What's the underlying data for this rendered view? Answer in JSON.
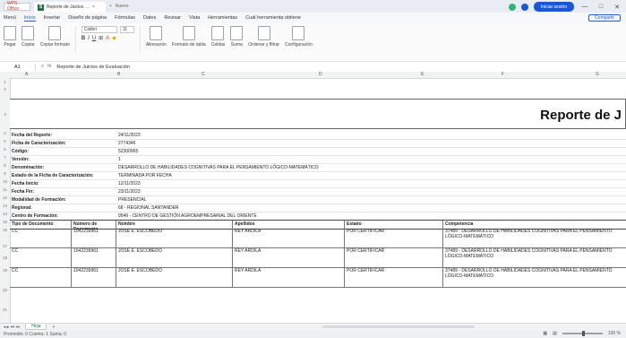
{
  "window": {
    "app_button": "WPS Office",
    "tab_title": "Reporte de Juicios Evaluativos",
    "tab_extra": "Nuevo",
    "signin": "Iniciar sesión",
    "min": "—",
    "max": "□",
    "close": "✕"
  },
  "menu": {
    "items": [
      "Menú",
      "Inicio",
      "Insertar",
      "Diseño de página",
      "Fórmulas",
      "Datos",
      "Revisar",
      "Vista",
      "Herramientas",
      "Cuál herramienta obtiene"
    ],
    "active_index": 1,
    "share": "Compartir"
  },
  "ribbon": {
    "paste": "Pegar",
    "copy": "Copiar",
    "format_painter": "Copiar formato",
    "font_name": "Calibri",
    "font_size": "11",
    "alignment": "Alineación",
    "format_table": "Formato de tabla",
    "cells": "Celdas",
    "sum": "Suma",
    "sort": "Ordenar y filtrar",
    "settings": "Configuración"
  },
  "formula": {
    "cell_ref": "A1",
    "content": "Reporte de Juicios de Evaluación"
  },
  "columns": [
    "A",
    "B",
    "C",
    "D",
    "E",
    "F",
    "G"
  ],
  "row_numbers": [
    "1",
    "2",
    "3",
    "4",
    "5",
    "6",
    "7",
    "8",
    "9",
    "10",
    "11",
    "12",
    "13",
    "14",
    "15",
    "16",
    "17",
    "18",
    "19",
    "20",
    "21"
  ],
  "report": {
    "title": "Reporte de J",
    "fields": [
      {
        "label": "Fecha del Reporte:",
        "value": "24/11/2023"
      },
      {
        "label": "Ficha de Caracterización:",
        "value": "2774346"
      },
      {
        "label": "Código:",
        "value": "52300905"
      },
      {
        "label": "Versión:",
        "value": "1"
      },
      {
        "label": "Denominación:",
        "value": "DESARROLLO DE HABILIDADES COGNITIVAS PARA EL PENSAMIENTO LÓGICO-MATEMÁTICO"
      },
      {
        "label": "Estado de la Ficha de Caracterización:",
        "value": "TERMINADA POR FECHA"
      },
      {
        "label": "Fecha Inicio:",
        "value": "12/11/2023"
      },
      {
        "label": "Fecha Fin:",
        "value": "23/11/2023"
      },
      {
        "label": "Modalidad de Formación:",
        "value": "PRESENCIAL"
      },
      {
        "label": "Regional:",
        "value": "68 - REGIONAL SANTANDER"
      },
      {
        "label": "Centro de Formación:",
        "value": "9546 - CENTRO DE GESTIÓN AGROEMPRESARIAL DEL ORIENTE"
      }
    ]
  },
  "table": {
    "headers": [
      "Tipo de Documento",
      "Número de Documento",
      "Nombre",
      "Apellidos",
      "Estado",
      "Competencia"
    ],
    "rows": [
      [
        "CC",
        "1042239961",
        "JOSÉ E. ESCOBEDO",
        "REY ARDILA",
        "POR CERTIFICAR",
        "37489 - DESARROLLO DE HABILIDADES COGNITIVAS PARA EL PENSAMIENTO LÓGICO-MATEMÁTICO"
      ],
      [
        "CC",
        "1042239961",
        "JOSÉ E. ESCOBEDO",
        "REY ARDILA",
        "POR CERTIFICAR",
        "37489 - DESARROLLO DE HABILIDADES COGNITIVAS PARA EL PENSAMIENTO LÓGICO-MATEMÁTICO"
      ],
      [
        "CC",
        "1042239961",
        "JOSÉ E. ESCOBEDO",
        "REY ARDILA",
        "POR CERTIFICAR",
        "37489 - DESARROLLO DE HABILIDADES COGNITIVAS PARA EL PENSAMIENTO LÓGICO-MATEMÁTICO"
      ]
    ]
  },
  "sheetbar": {
    "nav": "◂ ▸ ⏮ ⏭",
    "sheet_name": "Hoja",
    "add": "+"
  },
  "status": {
    "left": "Promedio: 0   Cuenta: 1   Suma: 0",
    "zoom": "100 %"
  }
}
